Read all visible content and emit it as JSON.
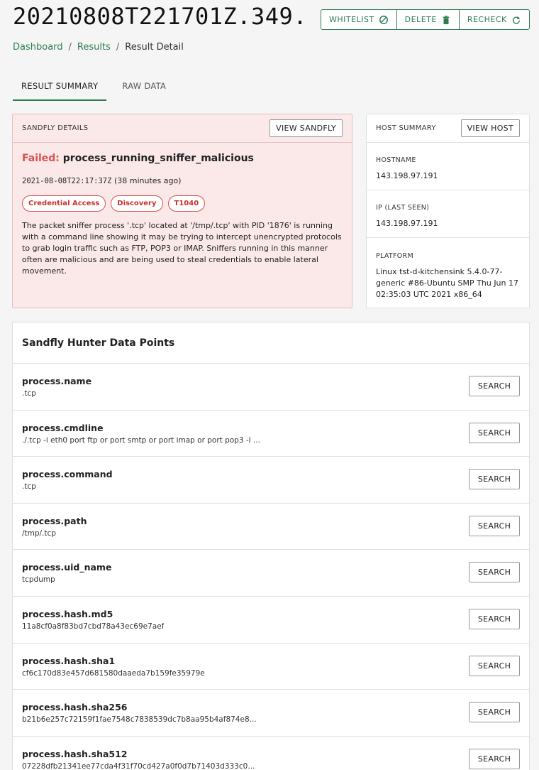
{
  "header": {
    "title": "20210808T221701Z.349..."
  },
  "actions": [
    {
      "label": "WHITELIST",
      "icon": "block-icon"
    },
    {
      "label": "DELETE",
      "icon": "trash-icon"
    },
    {
      "label": "RECHECK",
      "icon": "refresh-icon"
    }
  ],
  "breadcrumb": {
    "dashboard": "Dashboard",
    "results": "Results",
    "current": "Result Detail",
    "sep": "/"
  },
  "tabs": [
    {
      "label": "RESULT SUMMARY",
      "active": true
    },
    {
      "label": "RAW DATA",
      "active": false
    }
  ],
  "sandfly": {
    "header": "SANDFLY DETAILS",
    "view_button": "VIEW SANDFLY",
    "status": "Failed:",
    "name": "process_running_sniffer_malicious",
    "timestamp": "2021-08-08T22:17:37Z",
    "relative": "(38 minutes ago)",
    "tags": [
      "Credential Access",
      "Discovery",
      "T1040"
    ],
    "description": "The packet sniffer process '.tcp' located at '/tmp/.tcp' with PID '1876' is running with a command line showing it may be trying to intercept unencrypted protocols to grab login traffic such as FTP, POP3 or IMAP. Sniffers running in this manner often are malicious and are being used to steal credentials to enable lateral movement."
  },
  "host": {
    "header": "HOST SUMMARY",
    "view_button": "VIEW HOST",
    "hostname_label": "HOSTNAME",
    "hostname": "143.198.97.191",
    "ip_label": "IP (LAST SEEN)",
    "ip": "143.198.97.191",
    "platform_label": "PLATFORM",
    "platform": "Linux tst-d-kitchensink 5.4.0-77-generic #86-Ubuntu SMP Thu Jun 17 02:35:03 UTC 2021 x86_64"
  },
  "datapoints": {
    "title": "Sandfly Hunter Data Points",
    "button": "SEARCH",
    "rows": [
      {
        "name": "process.name",
        "value": ".tcp"
      },
      {
        "name": "process.cmdline",
        "value": "./.tcp -i eth0 port ftp or port smtp or port imap or port pop3 -l ..."
      },
      {
        "name": "process.command",
        "value": ".tcp"
      },
      {
        "name": "process.path",
        "value": "/tmp/.tcp"
      },
      {
        "name": "process.uid_name",
        "value": "tcpdump"
      },
      {
        "name": "process.hash.md5",
        "value": "11a8cf0a8f83bd7cbd78a43ec69e7aef"
      },
      {
        "name": "process.hash.sha1",
        "value": "cf6c170d83e457d681580daaeda7b159fe35979e"
      },
      {
        "name": "process.hash.sha256",
        "value": "b21b6e257c72159f1fae7548c7838539dc7b8aa95b4af874e8..."
      },
      {
        "name": "process.hash.sha512",
        "value": "07228dfb21341ee77cda4f31f70cd427a0f0d7b71403d333c0..."
      }
    ]
  },
  "colors": {
    "accent": "#2e7d52",
    "danger": "#d9534f",
    "alert_bg": "#fbe9e9"
  }
}
